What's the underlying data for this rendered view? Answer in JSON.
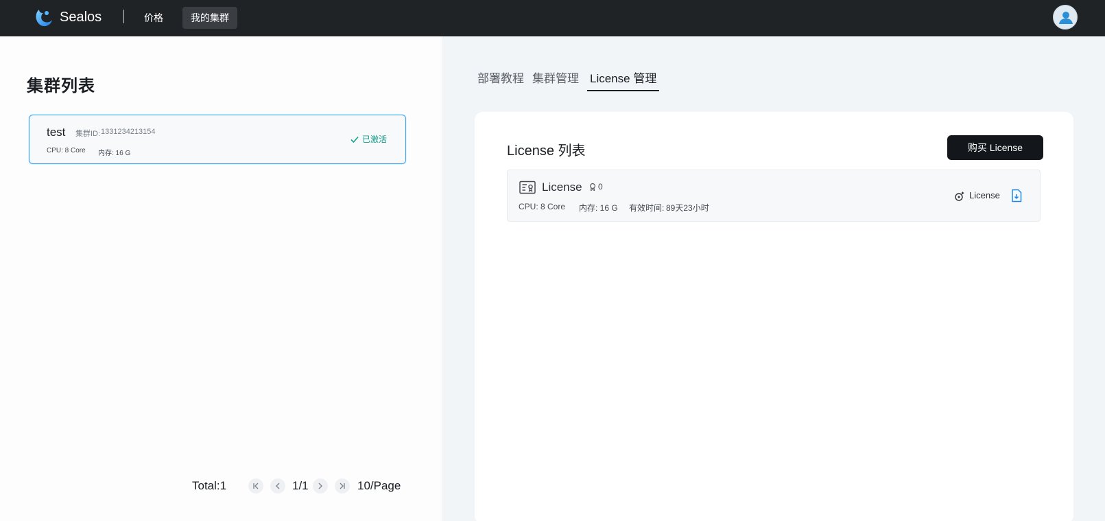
{
  "topbar": {
    "brand": "Sealos",
    "nav": [
      {
        "label": "价格"
      },
      {
        "label": "我的集群"
      }
    ],
    "avatar_icon": "user-avatar-icon"
  },
  "left": {
    "title": "集群列表",
    "clusters": [
      {
        "name": "test",
        "id_label": "集群ID:",
        "id_value": "1331234213154",
        "cpu": "CPU: 8 Core",
        "memory": "内存: 16 G",
        "status": "已激活",
        "status_color": "#12a08a"
      }
    ],
    "pagination": {
      "total": "Total:1",
      "page": "1/1",
      "page_size": "10/Page"
    }
  },
  "right": {
    "tabs": [
      {
        "label": "部署教程"
      },
      {
        "label": "集群管理"
      },
      {
        "label": "License 管理"
      }
    ],
    "active_tab": "License 管理",
    "panel": {
      "title": "License 列表",
      "buy_button": "购买 License",
      "licenses": [
        {
          "name": "License",
          "count": "0",
          "cpu": "CPU: 8 Core",
          "memory": "内存: 16 G",
          "valid_label": "有效时间:",
          "valid_value": "89天23小时",
          "action_label": "License"
        }
      ]
    }
  },
  "colors": {
    "topbar": "#202326",
    "accent_blue": "#36a3f7",
    "active_green": "#12a08a",
    "button_dark": "#13171b"
  }
}
